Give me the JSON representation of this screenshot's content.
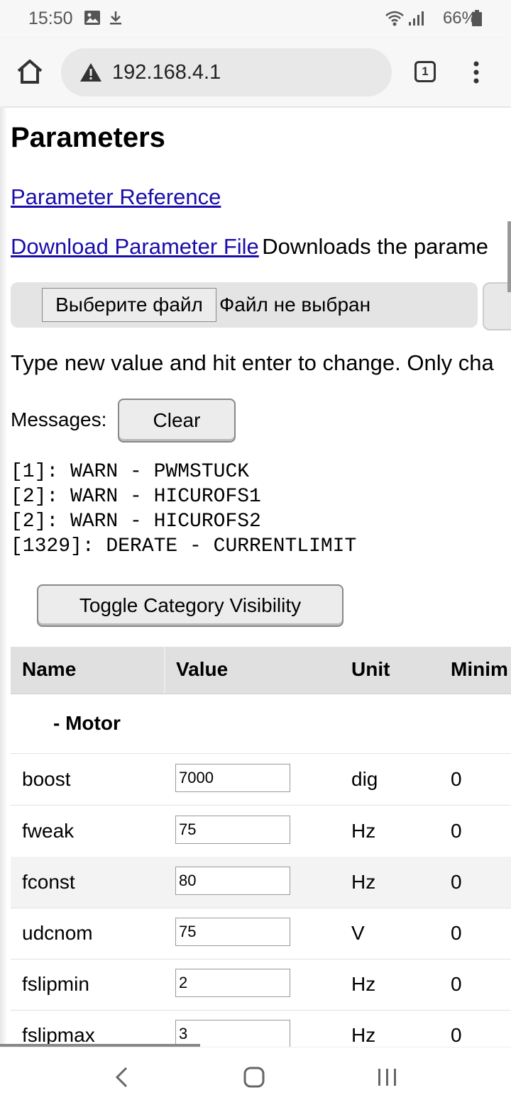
{
  "status_bar": {
    "time": "15:50",
    "battery": "66%",
    "icons": [
      "image-icon",
      "download-icon",
      "wifi-icon",
      "signal-icon",
      "battery-icon"
    ]
  },
  "browser": {
    "url": "192.168.4.1",
    "tab_count": "1"
  },
  "page": {
    "title": "Parameters",
    "param_ref_link": "Parameter Reference",
    "download_link": "Download Parameter File",
    "download_desc": "Downloads the parame",
    "file_button": "Выберите файл",
    "file_status": "Файл не выбран",
    "instructions": "Type new value and hit enter to change. Only cha",
    "messages_label": "Messages:",
    "clear_button": "Clear",
    "messages": [
      "[1]: WARN - PWMSTUCK",
      "[2]: WARN - HICUROFS1",
      "[2]: WARN - HICUROFS2",
      "[1329]: DERATE - CURRENTLIMIT"
    ],
    "toggle_button": "Toggle Category Visibility"
  },
  "table": {
    "headers": [
      "Name",
      "Value",
      "Unit",
      "Minim"
    ],
    "category": "- Motor",
    "rows": [
      {
        "name": "boost",
        "value": "7000",
        "unit": "dig",
        "min": "0"
      },
      {
        "name": "fweak",
        "value": "75",
        "unit": "Hz",
        "min": "0"
      },
      {
        "name": "fconst",
        "value": "80",
        "unit": "Hz",
        "min": "0"
      },
      {
        "name": "udcnom",
        "value": "75",
        "unit": "V",
        "min": "0"
      },
      {
        "name": "fslipmin",
        "value": "2",
        "unit": "Hz",
        "min": "0"
      },
      {
        "name": "fslipmax",
        "value": "3",
        "unit": "Hz",
        "min": "0"
      }
    ]
  },
  "nav": {
    "icons": [
      "back-icon",
      "home-icon",
      "recents-icon"
    ]
  }
}
